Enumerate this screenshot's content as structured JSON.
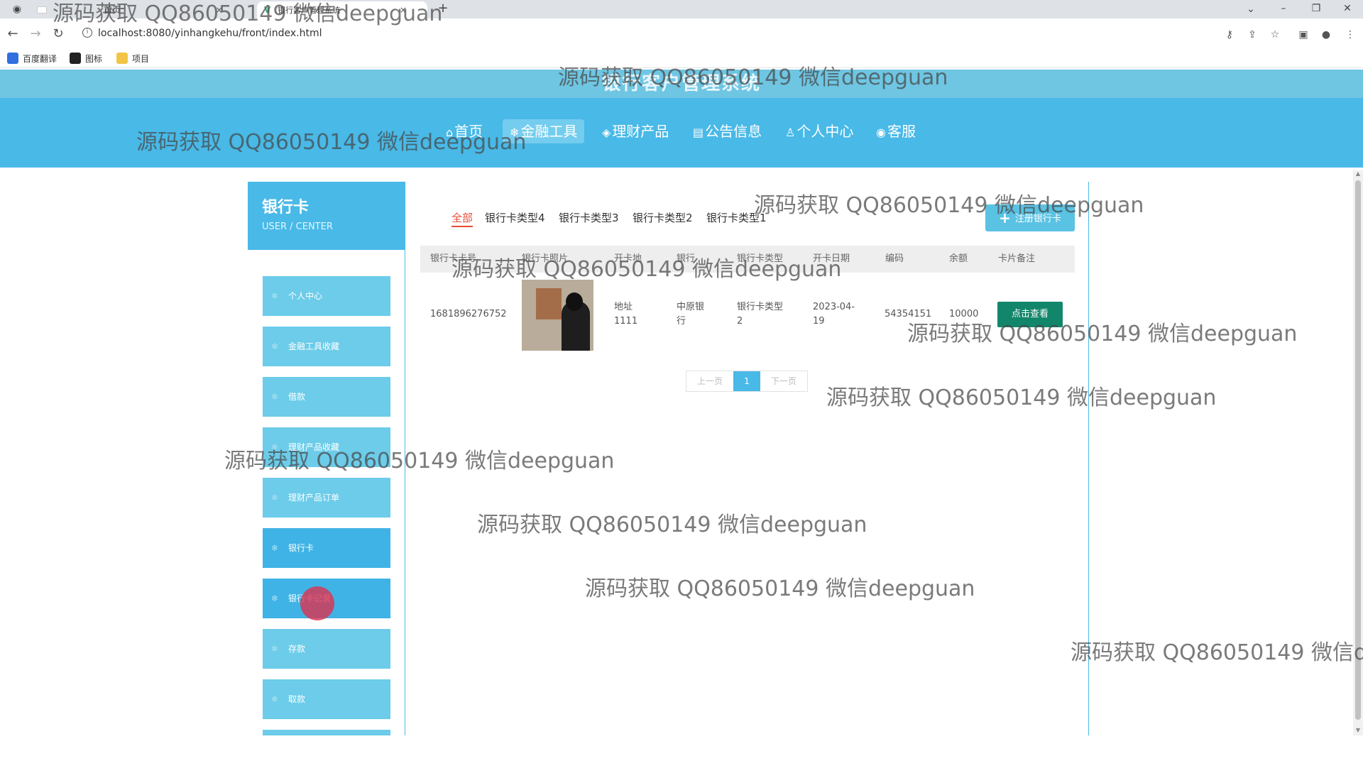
{
  "browser": {
    "tabs": [
      {
        "label": "首页",
        "close": "×"
      },
      {
        "label": "银行客户管理系统",
        "close": "×"
      }
    ],
    "new_tab": "+",
    "url": "localhost:8080/yinhangkehu/front/index.html",
    "bookmarks": [
      {
        "label": "百度翻译",
        "color": "#2f6fe0"
      },
      {
        "label": "图标",
        "color": "#222222"
      },
      {
        "label": "项目",
        "color": "#f3c546"
      }
    ]
  },
  "site": {
    "title": "银行客户管理系统",
    "nav": [
      {
        "icon": "⌂",
        "label": "首页"
      },
      {
        "icon": "❄",
        "label": "金融工具"
      },
      {
        "icon": "◈",
        "label": "理财产品"
      },
      {
        "icon": "▤",
        "label": "公告信息"
      },
      {
        "icon": "♙",
        "label": "个人中心"
      },
      {
        "icon": "◉",
        "label": "客服"
      }
    ]
  },
  "sidebar": {
    "title": "银行卡",
    "subtitle": "USER / CENTER",
    "items": [
      {
        "label": "个人中心"
      },
      {
        "label": "金融工具收藏"
      },
      {
        "label": "借款"
      },
      {
        "label": "理财产品收藏"
      },
      {
        "label": "理财产品订单"
      },
      {
        "label": "银行卡"
      },
      {
        "label": "银行卡记录"
      },
      {
        "label": "存款"
      },
      {
        "label": "取款"
      }
    ]
  },
  "main": {
    "filter_tabs": [
      "全部",
      "银行卡类型4",
      "银行卡类型3",
      "银行卡类型2",
      "银行卡类型1"
    ],
    "register_button": "注册银行卡",
    "columns": [
      "银行卡卡号",
      "银行卡照片",
      "开卡地",
      "银行",
      "银行卡类型",
      "开卡日期",
      "编码",
      "余额",
      "卡片备注"
    ],
    "rows": [
      {
        "card_no": "1681896276752",
        "location_l1": "地址",
        "location_l2": "1111",
        "bank_l1": "中原银",
        "bank_l2": "行",
        "type_l1": "银行卡类型",
        "type_l2": "2",
        "date_l1": "2023-04-",
        "date_l2": "19",
        "code": "54354151",
        "balance": "10000",
        "action": "点击查看"
      }
    ],
    "pager": {
      "prev": "上一页",
      "page": "1",
      "next": "下一页"
    }
  },
  "watermark_text": "源码获取 QQ86050149 微信deepguan",
  "watermark_partial": "源码获取 QQ86050149 微信d"
}
